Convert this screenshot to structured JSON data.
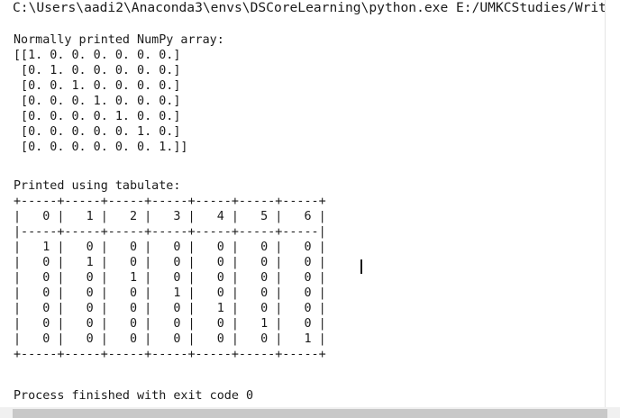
{
  "command_line": "C:\\Users\\aadi2\\Anaconda3\\envs\\DSCoreLearning\\python.exe E:/UMKCStudies/Writ",
  "output": {
    "numpy_header": "Normally printed NumPy array:",
    "numpy_rows": [
      "[[1. 0. 0. 0. 0. 0. 0.]",
      " [0. 1. 0. 0. 0. 0. 0.]",
      " [0. 0. 1. 0. 0. 0. 0.]",
      " [0. 0. 0. 1. 0. 0. 0.]",
      " [0. 0. 0. 0. 1. 0. 0.]",
      " [0. 0. 0. 0. 0. 1. 0.]",
      " [0. 0. 0. 0. 0. 0. 1.]]"
    ],
    "tabulate_header": "Printed using tabulate:",
    "table_lines": [
      "+-----+-----+-----+-----+-----+-----+-----+",
      "|   0 |   1 |   2 |   3 |   4 |   5 |   6 |",
      "|-----+-----+-----+-----+-----+-----+-----|",
      "|   1 |   0 |   0 |   0 |   0 |   0 |   0 |",
      "|   0 |   1 |   0 |   0 |   0 |   0 |   0 |",
      "|   0 |   0 |   1 |   0 |   0 |   0 |   0 |",
      "|   0 |   0 |   0 |   1 |   0 |   0 |   0 |",
      "|   0 |   0 |   0 |   0 |   1 |   0 |   0 |",
      "|   0 |   0 |   0 |   0 |   0 |   1 |   0 |",
      "|   0 |   0 |   0 |   0 |   0 |   0 |   1 |",
      "+-----+-----+-----+-----+-----+-----+-----+"
    ],
    "exit_message": "Process finished with exit code 0"
  }
}
